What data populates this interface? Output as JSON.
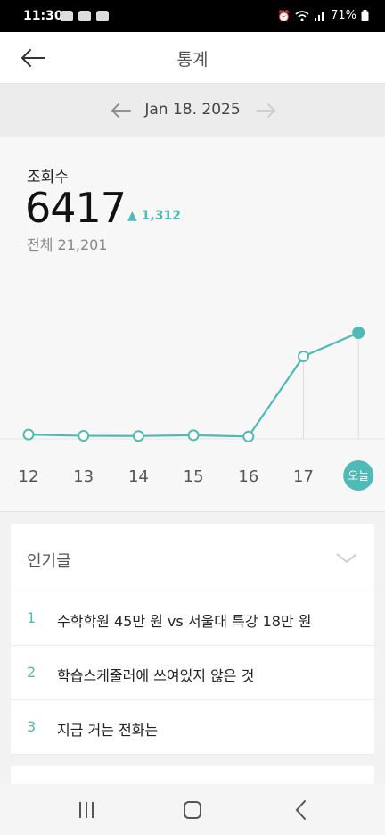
{
  "status_bar": {
    "time": "11:30",
    "battery": "71%"
  },
  "header": {
    "title": "통계"
  },
  "date_nav": {
    "date": "Jan 18. 2025"
  },
  "stats": {
    "label": "조회수",
    "value": "6417",
    "delta": "1,312",
    "total": "전체 21,201"
  },
  "chart_data": {
    "type": "line",
    "categories": [
      "12",
      "13",
      "14",
      "15",
      "16",
      "17",
      "오늘"
    ],
    "values": [
      158,
      80,
      70,
      116,
      40,
      4965,
      6417
    ],
    "note_values": "estimated from chart geometry; 오늘 = 6417, 17 derived from delta 1,312"
  },
  "popular": {
    "title": "인기글",
    "items": [
      {
        "rank": "1",
        "title": "수학학원 45만 원 vs 서울대 특강 18만 원"
      },
      {
        "rank": "2",
        "title": "학습스케줄러에 쓰여있지 않은 것"
      },
      {
        "rank": "3",
        "title": "지금 거는 전화는"
      }
    ]
  },
  "colors": {
    "accent": "#4fbab6"
  }
}
